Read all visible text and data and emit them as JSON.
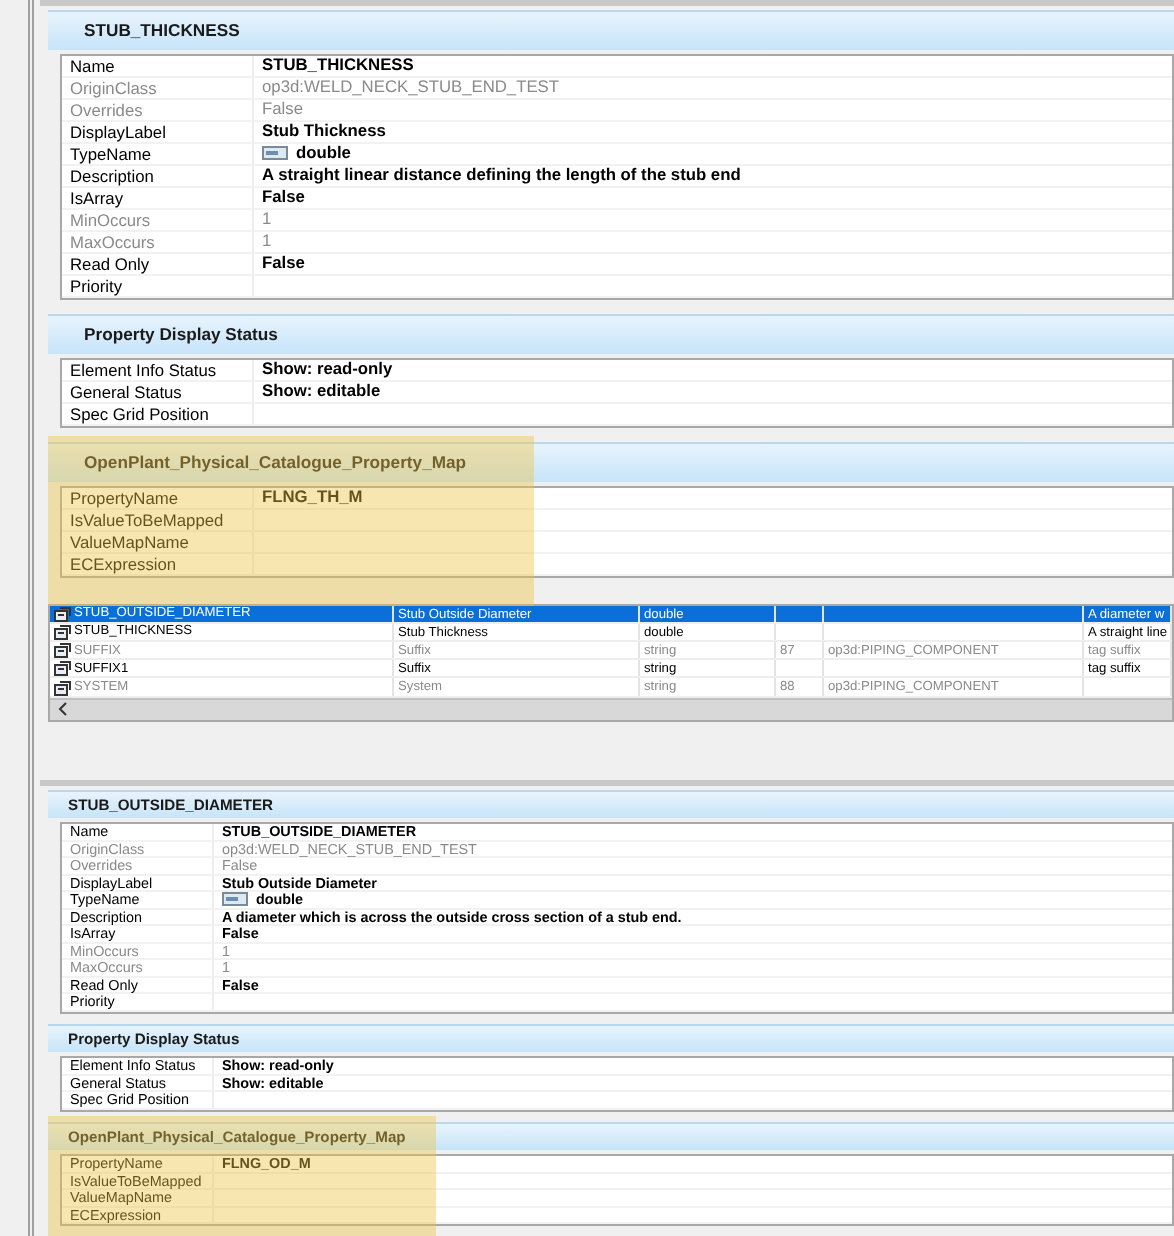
{
  "upper_details": {
    "sections": [
      {
        "title": "STUB_THICKNESS",
        "highlighted": false,
        "rows": [
          {
            "label": "Name",
            "value": "STUB_THICKNESS",
            "dimmed": false,
            "kind": "text"
          },
          {
            "label": "OriginClass",
            "value": "op3d:WELD_NECK_STUB_END_TEST",
            "dimmed": true,
            "kind": "text"
          },
          {
            "label": "Overrides",
            "value": "False",
            "dimmed": true,
            "kind": "text"
          },
          {
            "label": "DisplayLabel",
            "value": "Stub Thickness",
            "dimmed": false,
            "kind": "text"
          },
          {
            "label": "TypeName",
            "value": "double",
            "dimmed": false,
            "kind": "type"
          },
          {
            "label": "Description",
            "value": "A straight linear distance defining the length of the stub end",
            "dimmed": false,
            "kind": "text"
          },
          {
            "label": "IsArray",
            "value": "False",
            "dimmed": false,
            "kind": "text"
          },
          {
            "label": "MinOccurs",
            "value": "1",
            "dimmed": true,
            "kind": "text"
          },
          {
            "label": "MaxOccurs",
            "value": "1",
            "dimmed": true,
            "kind": "text"
          },
          {
            "label": "Read Only",
            "value": "False",
            "dimmed": false,
            "kind": "text"
          },
          {
            "label": "Priority",
            "dimmed": false,
            "kind": "text"
          }
        ]
      },
      {
        "title": "Property Display Status",
        "highlighted": false,
        "rows": [
          {
            "label": "Element Info Status",
            "value": "Show: read-only",
            "dimmed": false,
            "kind": "text"
          },
          {
            "label": "General Status",
            "value": "Show: editable",
            "dimmed": false,
            "kind": "text"
          },
          {
            "label": "Spec Grid Position",
            "dimmed": false,
            "kind": "text"
          }
        ]
      },
      {
        "title": "OpenPlant_Physical_Catalogue_Property_Map",
        "highlighted": true,
        "rows": [
          {
            "label": "PropertyName",
            "value": "FLNG_TH_M",
            "dimmed": false,
            "kind": "text"
          },
          {
            "label": "IsValueToBeMapped",
            "dimmed": false,
            "kind": "text"
          },
          {
            "label": "ValueMapName",
            "dimmed": false,
            "kind": "text"
          },
          {
            "label": "ECExpression",
            "dimmed": false,
            "kind": "text"
          }
        ]
      }
    ]
  },
  "property_grid": {
    "rows": [
      {
        "name": "STUB_OUTSIDE_DIAMETER",
        "label": "Stub Outside Diameter",
        "type": "double",
        "column_4": "",
        "origin": "",
        "description": "A diameter w",
        "dimmed": false,
        "selected": true
      },
      {
        "name": "STUB_THICKNESS",
        "label": "Stub Thickness",
        "type": "double",
        "column_4": "",
        "origin": "",
        "description": "A straight line",
        "dimmed": false,
        "selected": false
      },
      {
        "name": "SUFFIX",
        "label": "Suffix",
        "type": "string",
        "column_4": "87",
        "origin": "op3d:PIPING_COMPONENT",
        "description": "tag suffix",
        "dimmed": true,
        "selected": false
      },
      {
        "name": "SUFFIX1",
        "label": "Suffix",
        "type": "string",
        "column_4": "",
        "origin": "",
        "description": "tag suffix",
        "dimmed": false,
        "selected": false
      },
      {
        "name": "SYSTEM",
        "label": "System",
        "type": "string",
        "column_4": "88",
        "origin": "op3d:PIPING_COMPONENT",
        "description": "",
        "dimmed": true,
        "selected": false
      }
    ]
  },
  "lower_details": {
    "sections": [
      {
        "title": "STUB_OUTSIDE_DIAMETER",
        "highlighted": false,
        "rows": [
          {
            "label": "Name",
            "value": "STUB_OUTSIDE_DIAMETER",
            "dimmed": false,
            "kind": "text"
          },
          {
            "label": "OriginClass",
            "value": "op3d:WELD_NECK_STUB_END_TEST",
            "dimmed": true,
            "kind": "text"
          },
          {
            "label": "Overrides",
            "value": "False",
            "dimmed": true,
            "kind": "text"
          },
          {
            "label": "DisplayLabel",
            "value": "Stub Outside Diameter",
            "dimmed": false,
            "kind": "text"
          },
          {
            "label": "TypeName",
            "value": "double",
            "dimmed": false,
            "kind": "type"
          },
          {
            "label": "Description",
            "value": "A diameter which is across the outside cross section of a stub end.",
            "dimmed": false,
            "kind": "text"
          },
          {
            "label": "IsArray",
            "value": "False",
            "dimmed": false,
            "kind": "text"
          },
          {
            "label": "MinOccurs",
            "value": "1",
            "dimmed": true,
            "kind": "text"
          },
          {
            "label": "MaxOccurs",
            "value": "1",
            "dimmed": true,
            "kind": "text"
          },
          {
            "label": "Read Only",
            "value": "False",
            "dimmed": false,
            "kind": "text"
          },
          {
            "label": "Priority",
            "dimmed": false,
            "kind": "text"
          }
        ]
      },
      {
        "title": "Property Display Status",
        "highlighted": false,
        "rows": [
          {
            "label": "Element Info Status",
            "value": "Show: read-only",
            "dimmed": false,
            "kind": "text"
          },
          {
            "label": "General Status",
            "value": "Show: editable",
            "dimmed": false,
            "kind": "text"
          },
          {
            "label": "Spec Grid Position",
            "dimmed": false,
            "kind": "text"
          }
        ]
      },
      {
        "title": "OpenPlant_Physical_Catalogue_Property_Map",
        "highlighted": true,
        "rows": [
          {
            "label": "PropertyName",
            "value": "FLNG_OD_M",
            "dimmed": false,
            "kind": "text"
          },
          {
            "label": "IsValueToBeMapped",
            "dimmed": false,
            "kind": "text"
          },
          {
            "label": "ValueMapName",
            "dimmed": false,
            "kind": "text"
          },
          {
            "label": "ECExpression",
            "dimmed": false,
            "kind": "text"
          }
        ]
      }
    ]
  }
}
